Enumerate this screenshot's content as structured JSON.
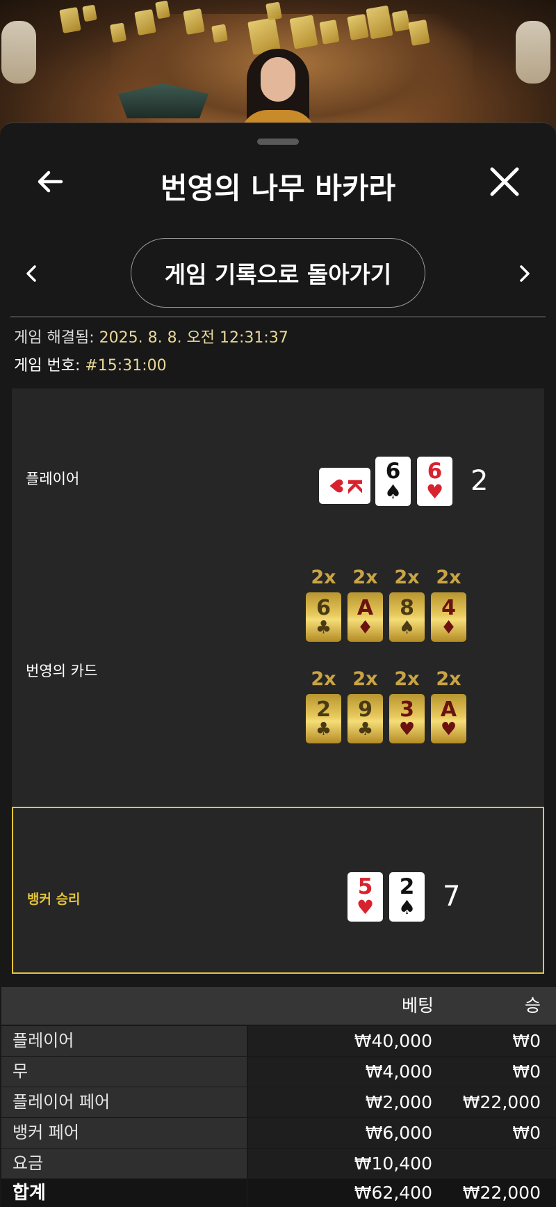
{
  "header": {
    "title": "번영의 나무 바카라",
    "back_button_icon": "arrow-left-icon",
    "close_button_icon": "close-icon"
  },
  "nav": {
    "back_to_history_label": "게임 기록으로 돌아가기"
  },
  "meta": {
    "resolved_label": "게임 해결됨:",
    "resolved_value": "2025. 8. 8. 오전 12:31:37",
    "game_no_label": "게임 번호:",
    "game_no_value": "#15:31:00"
  },
  "result": {
    "player": {
      "label": "플레이어",
      "cards": [
        {
          "rank": "K",
          "suit": "♥",
          "color": "red",
          "orientation": "sideways"
        },
        {
          "rank": "6",
          "suit": "♠",
          "color": "black"
        },
        {
          "rank": "6",
          "suit": "♥",
          "color": "red"
        }
      ],
      "total": "2"
    },
    "prosperity": {
      "label": "번영의 카드",
      "rows": [
        [
          {
            "mult": "2x",
            "rank": "6",
            "suit": "♣"
          },
          {
            "mult": "2x",
            "rank": "A",
            "suit": "♦"
          },
          {
            "mult": "2x",
            "rank": "8",
            "suit": "♠"
          },
          {
            "mult": "2x",
            "rank": "4",
            "suit": "♦"
          }
        ],
        [
          {
            "mult": "2x",
            "rank": "2",
            "suit": "♣"
          },
          {
            "mult": "2x",
            "rank": "9",
            "suit": "♣"
          },
          {
            "mult": "2x",
            "rank": "3",
            "suit": "♥"
          },
          {
            "mult": "2x",
            "rank": "A",
            "suit": "♥"
          }
        ]
      ]
    },
    "banker": {
      "label": "뱅커 승리",
      "cards": [
        {
          "rank": "5",
          "suit": "♥",
          "color": "red"
        },
        {
          "rank": "2",
          "suit": "♠",
          "color": "black"
        }
      ],
      "total": "7"
    }
  },
  "table": {
    "headers": {
      "bet": "베팅",
      "win": "승"
    },
    "rows": [
      {
        "name": "플레이어",
        "bet": "₩40,000",
        "win": "₩0"
      },
      {
        "name": "무",
        "bet": "₩4,000",
        "win": "₩0"
      },
      {
        "name": "플레이어 페어",
        "bet": "₩2,000",
        "win": "₩22,000"
      },
      {
        "name": "뱅커 페어",
        "bet": "₩6,000",
        "win": "₩0"
      },
      {
        "name": "요금",
        "bet": "₩10,400",
        "win": ""
      }
    ],
    "total": {
      "name": "합계",
      "bet": "₩62,400",
      "win": "₩22,000"
    }
  },
  "colors": {
    "accent_gold": "#e3c43a",
    "value_text": "#e8d89a",
    "card_red": "#d8222e"
  }
}
